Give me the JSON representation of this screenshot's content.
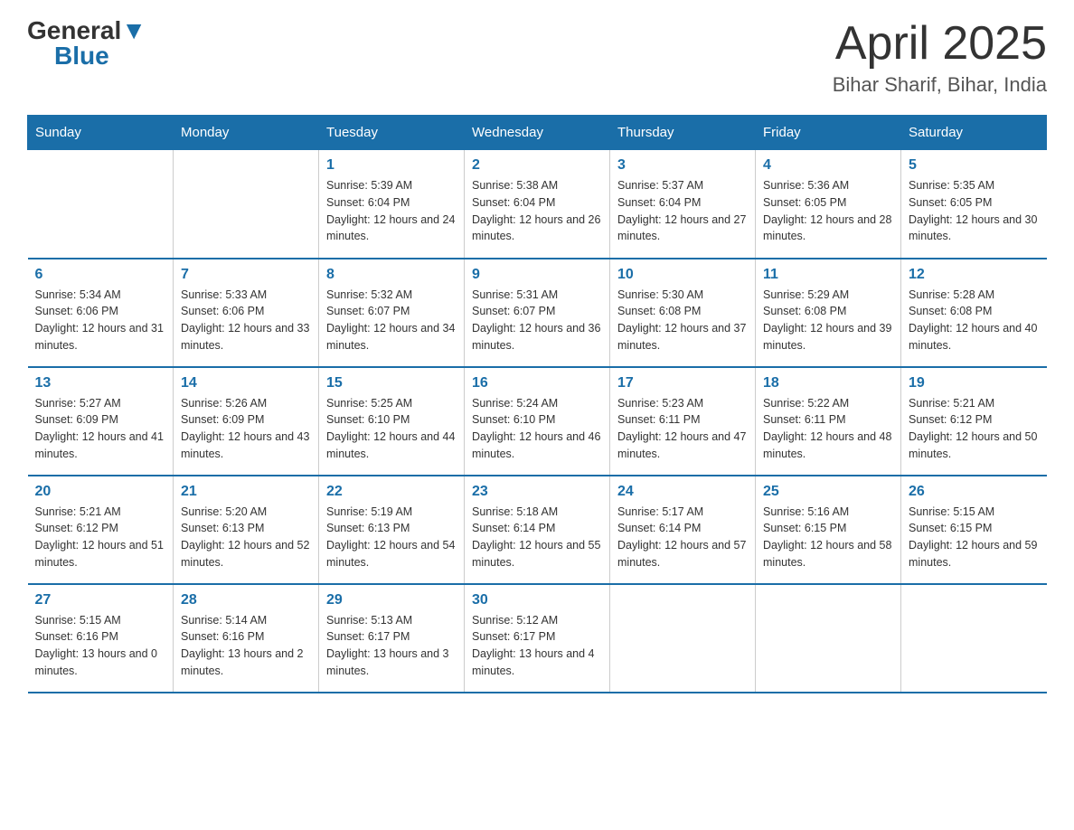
{
  "header": {
    "logo_general": "General",
    "logo_arrow": "▼",
    "logo_blue": "Blue",
    "month_year": "April 2025",
    "location": "Bihar Sharif, Bihar, India"
  },
  "days_of_week": [
    "Sunday",
    "Monday",
    "Tuesday",
    "Wednesday",
    "Thursday",
    "Friday",
    "Saturday"
  ],
  "weeks": [
    [
      {
        "day": "",
        "sunrise": "",
        "sunset": "",
        "daylight": ""
      },
      {
        "day": "",
        "sunrise": "",
        "sunset": "",
        "daylight": ""
      },
      {
        "day": "1",
        "sunrise": "Sunrise: 5:39 AM",
        "sunset": "Sunset: 6:04 PM",
        "daylight": "Daylight: 12 hours and 24 minutes."
      },
      {
        "day": "2",
        "sunrise": "Sunrise: 5:38 AM",
        "sunset": "Sunset: 6:04 PM",
        "daylight": "Daylight: 12 hours and 26 minutes."
      },
      {
        "day": "3",
        "sunrise": "Sunrise: 5:37 AM",
        "sunset": "Sunset: 6:04 PM",
        "daylight": "Daylight: 12 hours and 27 minutes."
      },
      {
        "day": "4",
        "sunrise": "Sunrise: 5:36 AM",
        "sunset": "Sunset: 6:05 PM",
        "daylight": "Daylight: 12 hours and 28 minutes."
      },
      {
        "day": "5",
        "sunrise": "Sunrise: 5:35 AM",
        "sunset": "Sunset: 6:05 PM",
        "daylight": "Daylight: 12 hours and 30 minutes."
      }
    ],
    [
      {
        "day": "6",
        "sunrise": "Sunrise: 5:34 AM",
        "sunset": "Sunset: 6:06 PM",
        "daylight": "Daylight: 12 hours and 31 minutes."
      },
      {
        "day": "7",
        "sunrise": "Sunrise: 5:33 AM",
        "sunset": "Sunset: 6:06 PM",
        "daylight": "Daylight: 12 hours and 33 minutes."
      },
      {
        "day": "8",
        "sunrise": "Sunrise: 5:32 AM",
        "sunset": "Sunset: 6:07 PM",
        "daylight": "Daylight: 12 hours and 34 minutes."
      },
      {
        "day": "9",
        "sunrise": "Sunrise: 5:31 AM",
        "sunset": "Sunset: 6:07 PM",
        "daylight": "Daylight: 12 hours and 36 minutes."
      },
      {
        "day": "10",
        "sunrise": "Sunrise: 5:30 AM",
        "sunset": "Sunset: 6:08 PM",
        "daylight": "Daylight: 12 hours and 37 minutes."
      },
      {
        "day": "11",
        "sunrise": "Sunrise: 5:29 AM",
        "sunset": "Sunset: 6:08 PM",
        "daylight": "Daylight: 12 hours and 39 minutes."
      },
      {
        "day": "12",
        "sunrise": "Sunrise: 5:28 AM",
        "sunset": "Sunset: 6:08 PM",
        "daylight": "Daylight: 12 hours and 40 minutes."
      }
    ],
    [
      {
        "day": "13",
        "sunrise": "Sunrise: 5:27 AM",
        "sunset": "Sunset: 6:09 PM",
        "daylight": "Daylight: 12 hours and 41 minutes."
      },
      {
        "day": "14",
        "sunrise": "Sunrise: 5:26 AM",
        "sunset": "Sunset: 6:09 PM",
        "daylight": "Daylight: 12 hours and 43 minutes."
      },
      {
        "day": "15",
        "sunrise": "Sunrise: 5:25 AM",
        "sunset": "Sunset: 6:10 PM",
        "daylight": "Daylight: 12 hours and 44 minutes."
      },
      {
        "day": "16",
        "sunrise": "Sunrise: 5:24 AM",
        "sunset": "Sunset: 6:10 PM",
        "daylight": "Daylight: 12 hours and 46 minutes."
      },
      {
        "day": "17",
        "sunrise": "Sunrise: 5:23 AM",
        "sunset": "Sunset: 6:11 PM",
        "daylight": "Daylight: 12 hours and 47 minutes."
      },
      {
        "day": "18",
        "sunrise": "Sunrise: 5:22 AM",
        "sunset": "Sunset: 6:11 PM",
        "daylight": "Daylight: 12 hours and 48 minutes."
      },
      {
        "day": "19",
        "sunrise": "Sunrise: 5:21 AM",
        "sunset": "Sunset: 6:12 PM",
        "daylight": "Daylight: 12 hours and 50 minutes."
      }
    ],
    [
      {
        "day": "20",
        "sunrise": "Sunrise: 5:21 AM",
        "sunset": "Sunset: 6:12 PM",
        "daylight": "Daylight: 12 hours and 51 minutes."
      },
      {
        "day": "21",
        "sunrise": "Sunrise: 5:20 AM",
        "sunset": "Sunset: 6:13 PM",
        "daylight": "Daylight: 12 hours and 52 minutes."
      },
      {
        "day": "22",
        "sunrise": "Sunrise: 5:19 AM",
        "sunset": "Sunset: 6:13 PM",
        "daylight": "Daylight: 12 hours and 54 minutes."
      },
      {
        "day": "23",
        "sunrise": "Sunrise: 5:18 AM",
        "sunset": "Sunset: 6:14 PM",
        "daylight": "Daylight: 12 hours and 55 minutes."
      },
      {
        "day": "24",
        "sunrise": "Sunrise: 5:17 AM",
        "sunset": "Sunset: 6:14 PM",
        "daylight": "Daylight: 12 hours and 57 minutes."
      },
      {
        "day": "25",
        "sunrise": "Sunrise: 5:16 AM",
        "sunset": "Sunset: 6:15 PM",
        "daylight": "Daylight: 12 hours and 58 minutes."
      },
      {
        "day": "26",
        "sunrise": "Sunrise: 5:15 AM",
        "sunset": "Sunset: 6:15 PM",
        "daylight": "Daylight: 12 hours and 59 minutes."
      }
    ],
    [
      {
        "day": "27",
        "sunrise": "Sunrise: 5:15 AM",
        "sunset": "Sunset: 6:16 PM",
        "daylight": "Daylight: 13 hours and 0 minutes."
      },
      {
        "day": "28",
        "sunrise": "Sunrise: 5:14 AM",
        "sunset": "Sunset: 6:16 PM",
        "daylight": "Daylight: 13 hours and 2 minutes."
      },
      {
        "day": "29",
        "sunrise": "Sunrise: 5:13 AM",
        "sunset": "Sunset: 6:17 PM",
        "daylight": "Daylight: 13 hours and 3 minutes."
      },
      {
        "day": "30",
        "sunrise": "Sunrise: 5:12 AM",
        "sunset": "Sunset: 6:17 PM",
        "daylight": "Daylight: 13 hours and 4 minutes."
      },
      {
        "day": "",
        "sunrise": "",
        "sunset": "",
        "daylight": ""
      },
      {
        "day": "",
        "sunrise": "",
        "sunset": "",
        "daylight": ""
      },
      {
        "day": "",
        "sunrise": "",
        "sunset": "",
        "daylight": ""
      }
    ]
  ]
}
